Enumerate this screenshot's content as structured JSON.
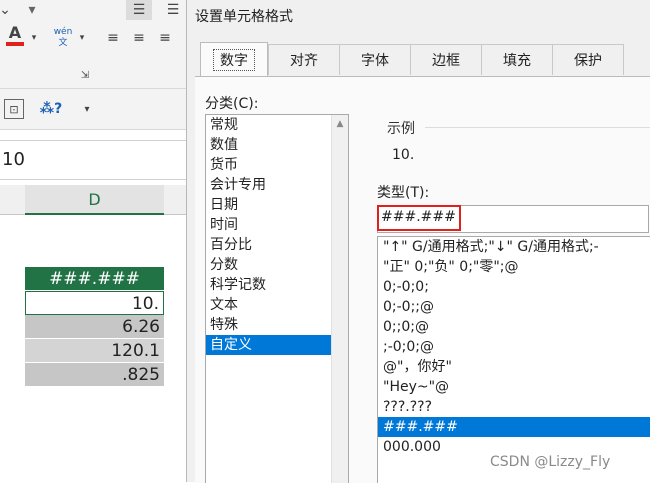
{
  "excel": {
    "font_color_label": "A",
    "phonetic_label": "wén 文",
    "formula_value": "10",
    "column_header": "D",
    "cells": [
      {
        "value": "###.###",
        "header": true
      },
      {
        "value": "10."
      },
      {
        "value": "6.26"
      },
      {
        "value": "120.1"
      },
      {
        "value": ".825"
      }
    ]
  },
  "dialog": {
    "title": "设置单元格格式",
    "tabs": [
      "数字",
      "对齐",
      "字体",
      "边框",
      "填充",
      "保护"
    ],
    "category_label": "分类(C):",
    "categories": [
      "常规",
      "数值",
      "货币",
      "会计专用",
      "日期",
      "时间",
      "百分比",
      "分数",
      "科学记数",
      "文本",
      "特殊",
      "自定义"
    ],
    "selected_category": "自定义",
    "sample_label": "示例",
    "sample_value": "10.",
    "type_label": "类型(T):",
    "type_value": "###.###",
    "formats": [
      "\"↑\" G/通用格式;\"↓\" G/通用格式;-",
      "\"正\" 0;\"负\" 0;\"零\";@",
      "0;-0;0;",
      "0;-0;;@",
      "0;;0;@",
      ";-0;0;@",
      "@\"，你好\"",
      "\"Hey~\"@",
      "???.???",
      "###.###",
      "000.000"
    ],
    "selected_format": "###.###"
  },
  "watermark": "CSDN @Lizzy_Fly",
  "colors": {
    "accent": "#0078d7",
    "excel_green": "#217346",
    "highlight_red": "#e0201a"
  }
}
